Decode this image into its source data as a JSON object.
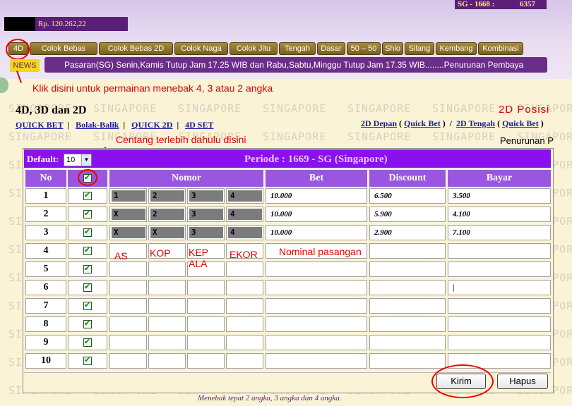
{
  "header": {
    "sg_label": "SG - 1668 :",
    "sg_value": "6357",
    "balance": "Rp. 120.262,22"
  },
  "menu": [
    "4D",
    "Colok Bebas",
    "Colok Bebas 2D",
    "Colok Naga",
    "Colok Jitu",
    "Tengah",
    "Dasar",
    "50 – 50",
    "Shio",
    "Silang",
    "Kembang",
    "Kombinasi"
  ],
  "news": {
    "label": "NEWS",
    "ticker": "Pasaran(SG) Senin,Kamis Tutup Jam 17.25 WIB dan Rabu,Sabtu,Minggu Tutup Jam 17.35 WIB........Penurunan Pembaya"
  },
  "annotations": {
    "click_hint": "Klik disini untuk permainan menebak 4, 3 atau 2 angka",
    "check_hint": "Centang terlebih dahulu disini",
    "as": "AS",
    "kop": "KOP",
    "kepala": "KEP\nALA",
    "ekor": "EKOR",
    "nominal": "Nominal pasangan"
  },
  "page": {
    "title": "4D, 3D dan 2D",
    "posisi": "2D Posisi",
    "watermark": "SINGAPORE",
    "links_left": [
      "QUICK BET",
      "Bolak-Balik",
      "QUICK 2D",
      "4D SET"
    ],
    "depan": "2D Depan",
    "tengah": "2D Tengah",
    "quick_bet": "Quick Bet",
    "penurunan": "Penurunan P"
  },
  "form": {
    "default_label": "Default:",
    "default_value": "10",
    "periode": "Periode : 1669 - SG (Singapore)",
    "columns": {
      "no": "No",
      "nomor": "Nomor",
      "bet": "Bet",
      "discount": "Discount",
      "bayar": "Bayar"
    },
    "rows": [
      {
        "no": "1",
        "nomor": [
          "1",
          "2",
          "3",
          "4"
        ],
        "bet": "10.000",
        "discount": "6.500",
        "bayar": "3.500"
      },
      {
        "no": "2",
        "nomor": [
          "X",
          "2",
          "3",
          "4"
        ],
        "bet": "10.000",
        "discount": "5.900",
        "bayar": "4.100"
      },
      {
        "no": "3",
        "nomor": [
          "X",
          "X",
          "3",
          "4"
        ],
        "bet": "10.000",
        "discount": "2.900",
        "bayar": "7.100"
      },
      {
        "no": "4",
        "nomor": [
          "",
          "",
          "",
          ""
        ],
        "bet": "",
        "discount": "",
        "bayar": ""
      },
      {
        "no": "5",
        "nomor": [
          "",
          "",
          "",
          ""
        ],
        "bet": "",
        "discount": "",
        "bayar": ""
      },
      {
        "no": "6",
        "nomor": [
          "",
          "",
          "",
          ""
        ],
        "bet": "",
        "discount": "",
        "bayar": "|"
      },
      {
        "no": "7",
        "nomor": [
          "",
          "",
          "",
          ""
        ],
        "bet": "",
        "discount": "",
        "bayar": ""
      },
      {
        "no": "8",
        "nomor": [
          "",
          "",
          "",
          ""
        ],
        "bet": "",
        "discount": "",
        "bayar": ""
      },
      {
        "no": "9",
        "nomor": [
          "",
          "",
          "",
          ""
        ],
        "bet": "",
        "discount": "",
        "bayar": ""
      },
      {
        "no": "10",
        "nomor": [
          "",
          "",
          "",
          ""
        ],
        "bet": "",
        "discount": "",
        "bayar": ""
      }
    ],
    "kirim": "Kirim",
    "hapus": "Hapus",
    "footnote": "Menebak tepat 2 angka, 3 angka dan 4 angka."
  }
}
